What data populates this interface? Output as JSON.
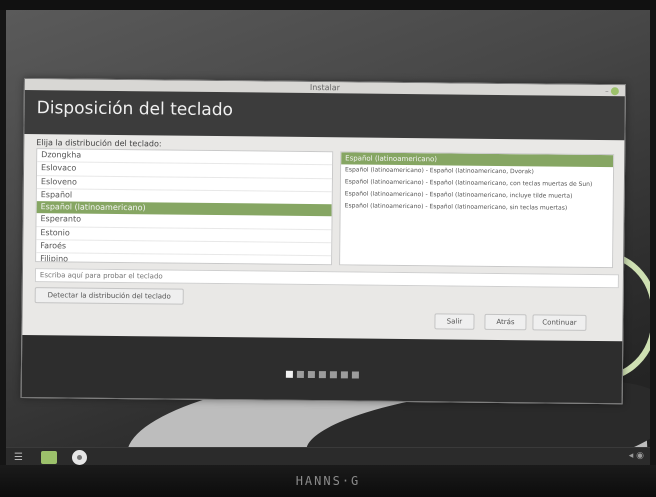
{
  "window": {
    "title": "Instalar",
    "heading": "Disposición del teclado",
    "prompt": "Elija la distribución del teclado:"
  },
  "layouts": [
    {
      "label": "Dzongkha",
      "selected": false
    },
    {
      "label": "Eslovaco",
      "selected": false
    },
    {
      "label": "Esloveno",
      "selected": false
    },
    {
      "label": "Español",
      "selected": false
    },
    {
      "label": "Español (latinoamericano)",
      "selected": true
    },
    {
      "label": "Esperanto",
      "selected": false
    },
    {
      "label": "Estonio",
      "selected": false
    },
    {
      "label": "Faroés",
      "selected": false
    },
    {
      "label": "Filipino",
      "selected": false
    }
  ],
  "variants": [
    {
      "label": "Español (latinoamericano)",
      "selected": true
    },
    {
      "label": "Español (latinoamericano) - Español (latinoamericano, Dvorak)",
      "selected": false
    },
    {
      "label": "Español (latinoamericano) - Español (latinoamericano, con teclas muertas de Sun)",
      "selected": false
    },
    {
      "label": "Español (latinoamericano) - Español (latinoamericano, incluye tilde muerta)",
      "selected": false
    },
    {
      "label": "Español (latinoamericano) - Español (latinoamericano, sin teclas muertas)",
      "selected": false
    }
  ],
  "test_input": {
    "placeholder": "Escriba aquí para probar el teclado",
    "value": ""
  },
  "buttons": {
    "detect": "Detectar la distribución del teclado",
    "quit": "Salir",
    "back": "Atrás",
    "continue": "Continuar"
  },
  "progress": {
    "total_steps": 7,
    "current_step": 1
  },
  "monitor": {
    "brand": "HANNS·G"
  },
  "colors": {
    "selection": "#86a663",
    "header": "#3c3c3c",
    "accent": "#9cc16b"
  }
}
